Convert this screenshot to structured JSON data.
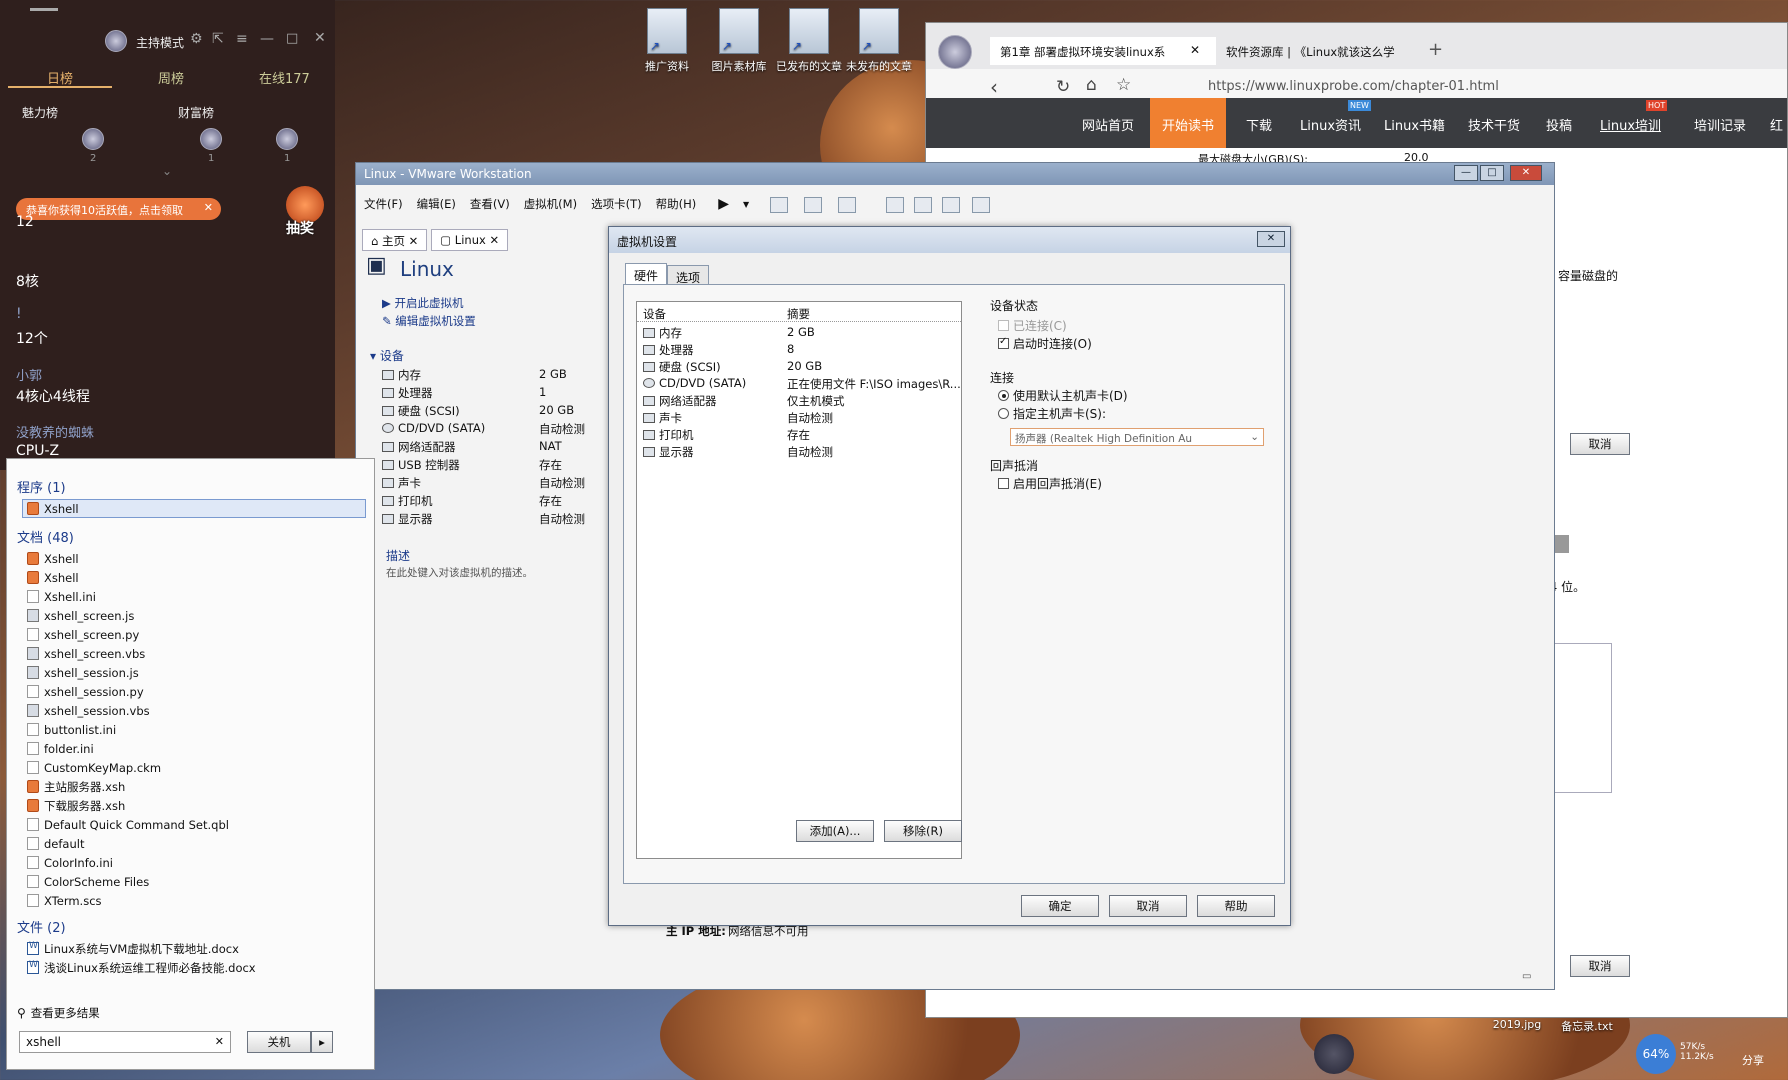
{
  "desktop": {
    "icons": [
      {
        "label": "推广资料"
      },
      {
        "label": "图片素材库"
      },
      {
        "label": "已发布的文章"
      },
      {
        "label": "未发布的文章"
      }
    ],
    "bottom_icons": [
      {
        "label": "2019.jpg"
      },
      {
        "label": "备忘录.txt"
      }
    ],
    "net_speed": {
      "percent": "64%",
      "up": "57K/s",
      "down": "11.2K/s"
    },
    "share_label": "分享"
  },
  "live_panel": {
    "mode_label": "主持模式",
    "tabs": [
      "日榜",
      "周榜",
      "在线177"
    ],
    "rank_headers": [
      "魅力榜",
      "财富榜"
    ],
    "rank_counts": [
      "2",
      "1",
      "1"
    ],
    "chat": [
      {
        "text": "12"
      },
      {
        "text": "8核"
      },
      {
        "text": "!"
      },
      {
        "text": "12个"
      },
      {
        "name": "小郭",
        "text": "4核心4线程"
      },
      {
        "name": "没教养的蜘蛛",
        "text": "CPU-Z"
      }
    ],
    "notice": "恭喜你获得10活跃值，点击领取",
    "prize_label": "抽奖"
  },
  "search_panel": {
    "programs_header": "程序 (1)",
    "program": "Xshell",
    "docs_header": "文档 (48)",
    "docs": [
      {
        "name": "Xshell",
        "icon": "x"
      },
      {
        "name": "Xshell",
        "icon": "x"
      },
      {
        "name": "Xshell.ini",
        "icon": ""
      },
      {
        "name": "xshell_screen.js",
        "icon": "g"
      },
      {
        "name": "xshell_screen.py",
        "icon": ""
      },
      {
        "name": "xshell_screen.vbs",
        "icon": "g"
      },
      {
        "name": "xshell_session.js",
        "icon": "g"
      },
      {
        "name": "xshell_session.py",
        "icon": ""
      },
      {
        "name": "xshell_session.vbs",
        "icon": "g"
      },
      {
        "name": "buttonlist.ini",
        "icon": ""
      },
      {
        "name": "folder.ini",
        "icon": ""
      },
      {
        "name": "CustomKeyMap.ckm",
        "icon": ""
      },
      {
        "name": "主站服务器.xsh",
        "icon": "x"
      },
      {
        "name": "下载服务器.xsh",
        "icon": "x"
      },
      {
        "name": "Default Quick Command Set.qbl",
        "icon": ""
      },
      {
        "name": "default",
        "icon": ""
      },
      {
        "name": "ColorInfo.ini",
        "icon": ""
      },
      {
        "name": "ColorScheme Files",
        "icon": ""
      },
      {
        "name": "XTerm.scs",
        "icon": ""
      }
    ],
    "files_header": "文件 (2)",
    "files": [
      {
        "name": "Linux系统与VM虚拟机下载地址.docx"
      },
      {
        "name": "浅谈Linux系统运维工程师必备技能.docx"
      }
    ],
    "more_results": "查看更多结果",
    "query": "xshell",
    "shutdown_label": "关机"
  },
  "vmware": {
    "title": "Linux - VMware Workstation",
    "menu": [
      "文件(F)",
      "编辑(E)",
      "查看(V)",
      "虚拟机(M)",
      "选项卡(T)",
      "帮助(H)"
    ],
    "tabs": [
      "主页",
      "Linux"
    ],
    "vm_name": "Linux",
    "actions": [
      "开启此虚拟机",
      "编辑虚拟机设置"
    ],
    "devices_header": "设备",
    "devices": [
      {
        "name": "内存",
        "value": "2 GB"
      },
      {
        "name": "处理器",
        "value": "1"
      },
      {
        "name": "硬盘 (SCSI)",
        "value": "20 GB"
      },
      {
        "name": "CD/DVD (SATA)",
        "value": "自动检测"
      },
      {
        "name": "网络适配器",
        "value": "NAT"
      },
      {
        "name": "USB 控制器",
        "value": "存在"
      },
      {
        "name": "声卡",
        "value": "自动检测"
      },
      {
        "name": "打印机",
        "value": "存在"
      },
      {
        "name": "显示器",
        "value": "自动检测"
      }
    ],
    "desc_header": "描述",
    "desc_placeholder": "在此处键入对该虚拟机的描述。",
    "ip_label": "主 IP 地址:",
    "ip_value": "网络信息不可用"
  },
  "dialog": {
    "title": "虚拟机设置",
    "tabs": [
      "硬件",
      "选项"
    ],
    "col_device": "设备",
    "col_summary": "摘要",
    "devices": [
      {
        "name": "内存",
        "value": "2 GB"
      },
      {
        "name": "处理器",
        "value": "8"
      },
      {
        "name": "硬盘 (SCSI)",
        "value": "20 GB"
      },
      {
        "name": "CD/DVD (SATA)",
        "value": "正在使用文件 F:\\ISO images\\R..."
      },
      {
        "name": "网络适配器",
        "value": "仅主机模式"
      },
      {
        "name": "声卡",
        "value": "自动检测"
      },
      {
        "name": "打印机",
        "value": "存在"
      },
      {
        "name": "显示器",
        "value": "自动检测"
      }
    ],
    "add_button": "添加(A)...",
    "remove_button": "移除(R)",
    "status_header": "设备状态",
    "connected": "已连接(C)",
    "connect_at_power_on": "启动时连接(O)",
    "connection_header": "连接",
    "use_default": "使用默认主机声卡(D)",
    "specify": "指定主机声卡(S):",
    "sound_card": "扬声器 (Realtek High Definition Au",
    "echo_header": "回声抵消",
    "enable_echo": "启用回声抵消(E)",
    "ok": "确定",
    "cancel": "取消",
    "help": "帮助"
  },
  "browser": {
    "tabs": [
      {
        "label": "第1章 部署虚拟环境安装linux系"
      },
      {
        "label": "软件资源库 | 《Linux就该这么学"
      }
    ],
    "url": "https://www.linuxprobe.com/chapter-01.html",
    "nav": [
      "网站首页",
      "开始读书",
      "下载",
      "Linux资讯",
      "Linux书籍",
      "技术干货",
      "投稿",
      "Linux培训",
      "培训记录",
      "红"
    ],
    "nav_badges": [
      "NEW",
      "HOT"
    ],
    "disk_size_label": "最大磁盘大小(GB)(S):",
    "disk_size_value": "20.0",
    "partial_text_1": "容量磁盘的",
    "partial_text_2": "64 位。",
    "cancel_1": "取消",
    "cancel_2": "取消"
  },
  "colors": {
    "vm_title": "#8aa0c0",
    "accent": "#f08030",
    "panel_bg": "#2f1f1d"
  }
}
